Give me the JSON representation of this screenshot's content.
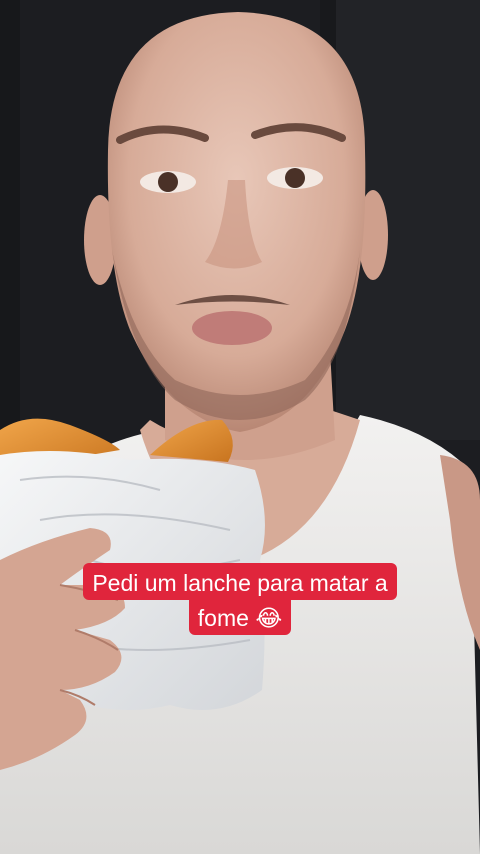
{
  "video": {
    "caption_lines": [
      "Pedi um lanche para matar a",
      "fome 😂"
    ]
  },
  "colors": {
    "caption_background": "#e0253c",
    "caption_text": "#ffffff"
  }
}
